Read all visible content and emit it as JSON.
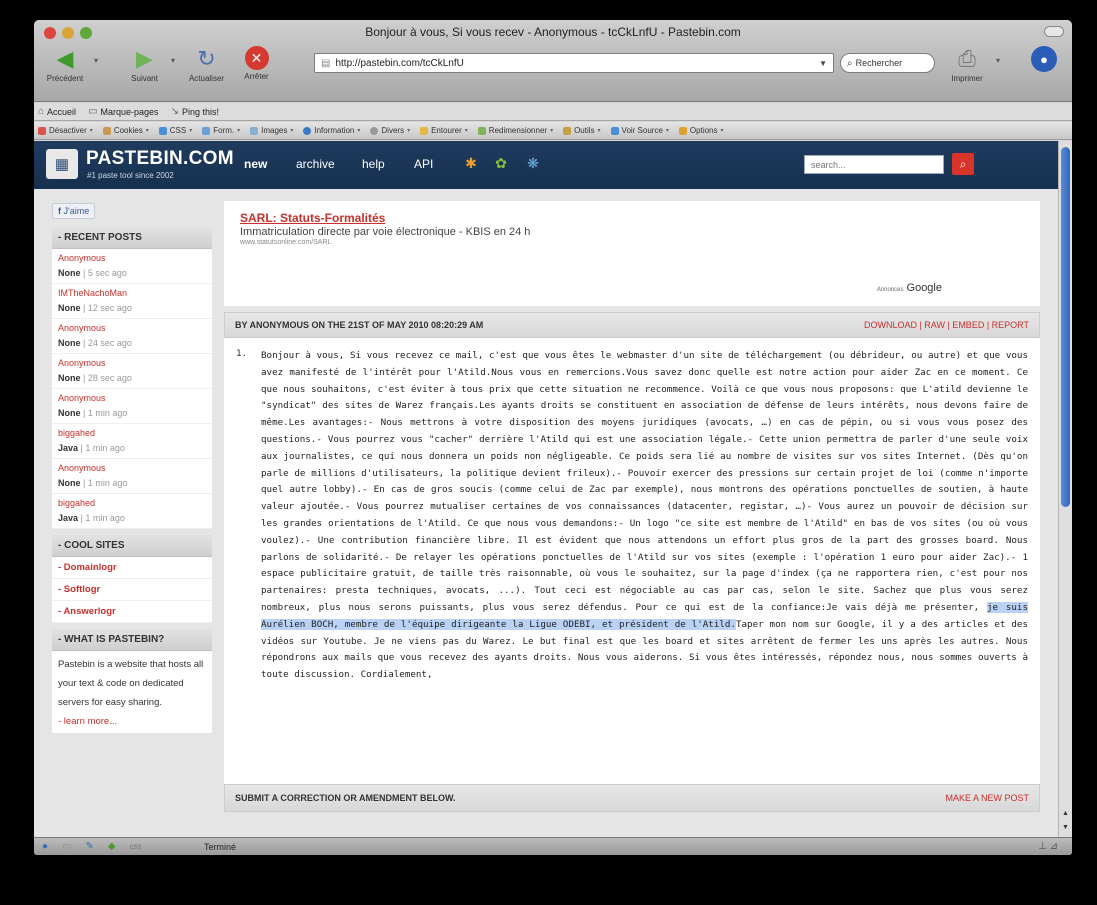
{
  "window": {
    "title": "Bonjour à vous, Si vous recev - Anonymous - tcCkLnfU - Pastebin.com"
  },
  "toolbar": {
    "back_label": "Précédent",
    "forward_label": "Suivant",
    "reload_label": "Actualiser",
    "stop_label": "Arrêter",
    "print_label": "Imprimer",
    "url": "http://pastebin.com/tcCkLnfU",
    "search_placeholder": "Rechercher"
  },
  "bookmarks": [
    "Accueil",
    "Marque-pages",
    "Ping this!"
  ],
  "devbar": [
    "Désactiver",
    "Cookies",
    "CSS",
    "Form.",
    "Images",
    "Information",
    "Divers",
    "Entourer",
    "Redimensionner",
    "Outils",
    "Voir Source",
    "Options"
  ],
  "pastebin": {
    "logo": "PASTEBIN.COM",
    "tagline": "#1 paste tool since 2002",
    "nav": {
      "new": "new",
      "archive": "archive",
      "help": "help",
      "api": "API"
    },
    "search_placeholder": "search..."
  },
  "sidebar": {
    "like": "J'aime",
    "recent_title": "- RECENT POSTS",
    "recent": [
      {
        "name": "Anonymous",
        "lang": "None",
        "age": "5 sec ago"
      },
      {
        "name": "IMTheNachoMan",
        "lang": "None",
        "age": "12 sec ago"
      },
      {
        "name": "Anonymous",
        "lang": "None",
        "age": "24 sec ago"
      },
      {
        "name": "Anonymous",
        "lang": "None",
        "age": "28 sec ago"
      },
      {
        "name": "Anonymous",
        "lang": "None",
        "age": "1 min ago"
      },
      {
        "name": "biggahed",
        "lang": "Java",
        "age": "1 min ago"
      },
      {
        "name": "Anonymous",
        "lang": "None",
        "age": "1 min ago"
      },
      {
        "name": "biggahed",
        "lang": "Java",
        "age": "1 min ago"
      }
    ],
    "cool_title": "- COOL SITES",
    "cool": [
      "- Domainlogr",
      "- Softlogr",
      "- Answerlogr"
    ],
    "what_title": "- WHAT IS PASTEBIN?",
    "what_text": "Pastebin is a website that hosts all your text & code on dedicated servers for easy sharing.",
    "learn_more": "- learn more..."
  },
  "ad": {
    "title": "SARL: Statuts-Formalités",
    "desc": "Immatriculation directe par voie électronique - KBIS en 24 h",
    "url": "www.statutsonline.com/SARL",
    "annonces": "Annonces",
    "google": "Google"
  },
  "paste": {
    "by": "BY ANONYMOUS ON THE 21ST OF MAY 2010 08:20:29 AM",
    "actions": "DOWNLOAD | RAW | EMBED | REPORT",
    "line_number": "1.",
    "text_before": "Bonjour à vous, Si vous recevez ce mail, c'est que vous êtes le webmaster d'un site de téléchargement (ou débrideur, ou autre) et que vous avez manifesté de l'intérêt pour l'Atild.Nous vous en remercions.Vous savez donc quelle est notre action pour aider Zac en ce moment. Ce que nous souhaitons, c'est éviter à tous prix que cette situation ne recommence. Voilà ce que vous nous proposons: que L'atild devienne le \"syndicat\" des sites de Warez français.Les ayants droits se constituent en association de défense de leurs intérêts, nous devons faire de même.Les avantages:- Nous mettrons à votre disposition des moyens juridiques (avocats, …) en cas de pépin, ou si vous vous posez des questions.- Vous pourrez vous \"cacher\" derrière l'Atild qui est une association légale.- Cette union permettra de parler d'une seule voix aux journalistes, ce qui nous donnera un poids non négligeable. Ce poids sera lié au nombre de visites sur vos sites Internet. (Dès qu'on parle de millions d'utilisateurs, la politique devient frileux).- Pouvoir exercer des pressions sur certain projet de loi (comme n'importe quel autre lobby).- En cas de gros soucis (comme celui de Zac par exemple), nous montrons des opérations ponctuelles de soutien, à haute valeur ajoutée.- Vous pourrez mutualiser certaines de vos connaissances (datacenter, registar, …)- Vous aurez un pouvoir de décision sur les grandes orientations de l'Atild. Ce que nous vous demandons:- Un logo \"ce site est membre de l'Atild\" en bas de vos sites (ou où vous voulez).- Une contribution financière libre. Il est évident que nous attendons un effort plus gros de la part des grosses board. Nous parlons de solidarité.- De relayer les opérations ponctuelles de l'Atild sur vos sites (exemple : l'opération 1 euro pour aider Zac).- 1 espace publicitaire gratuit, de taille très raisonnable, où vous le souhaitez, sur la page d'index (ça ne rapportera rien, c'est pour nos partenaires: presta techniques, avocats, ...). Tout ceci est négociable au cas par cas, selon le site. Sachez que plus vous serez nombreux, plus nous serons puissants, plus vous serez défendus. Pour ce qui est de la confiance:Je vais déjà me présenter, ",
    "text_highlight": "je suis Aurélien BOCH, membre de l'équipe dirigeante la Ligue ODEBI, et président de l'Atild.",
    "text_after": "Taper mon nom sur Google, il y a des articles et des vidéos sur Youtube. Je ne viens pas du Warez. Le but final est que les board et sites arrêtent de fermer les uns après les autres. Nous répondrons aux mails que vous recevez des ayants droits. Nous vous aiderons. Si vous êtes intéressés, répondez nous, nous sommes ouverts à toute discussion. Cordialement,"
  },
  "submit": {
    "label": "SUBMIT A CORRECTION OR AMENDMENT BELOW.",
    "new_post": "MAKE A NEW POST"
  },
  "status": {
    "text": "Terminé"
  }
}
